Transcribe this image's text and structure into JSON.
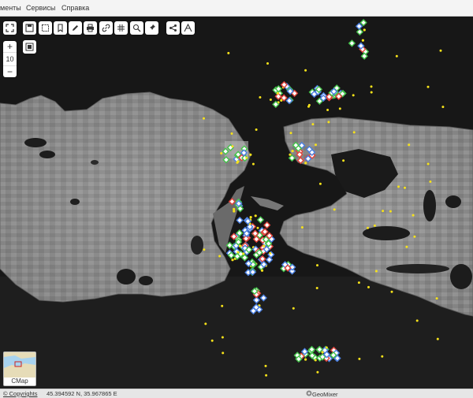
{
  "menu": {
    "items": [
      "менты",
      "Сервисы",
      "Справка"
    ]
  },
  "zoom": {
    "plus": "+",
    "level": "10",
    "minus": "−"
  },
  "toolbar": {
    "icons": [
      "fullscreen-icon",
      "save-icon",
      "select-area-icon",
      "bookmark-icon",
      "draw-pencil-icon",
      "print-icon",
      "link-icon",
      "grid-icon",
      "satellite-search-icon",
      "pin-icon",
      "share-icon",
      "measure-icon"
    ]
  },
  "minimap": {
    "label": "CMap"
  },
  "status": {
    "copyrights": "© Copyrights",
    "coordinates": "45.394592 N, 35.967865 E",
    "brand": "GeoMixer"
  },
  "colors": {
    "marker_yellow": "#f6e21a",
    "marker_green": "#46c24c",
    "marker_blue": "#4a7fe0",
    "marker_red": "#e0443c",
    "marker_white": "#ffffff"
  }
}
